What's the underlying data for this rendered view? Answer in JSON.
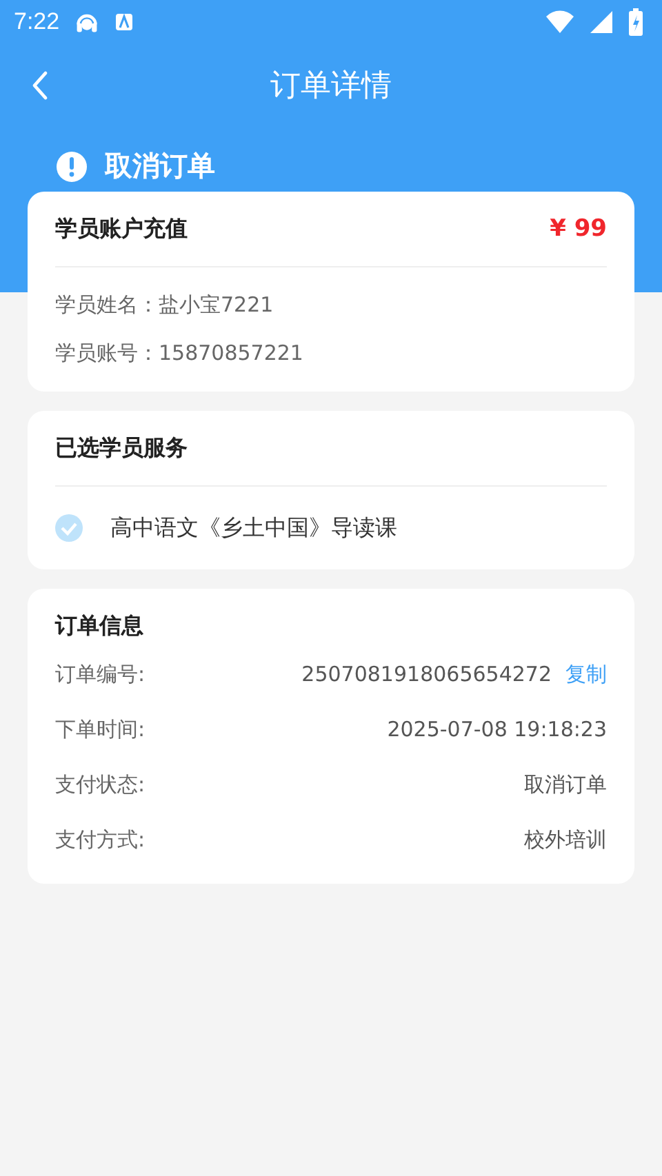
{
  "status_bar": {
    "time": "7:22"
  },
  "nav": {
    "title": "订单详情"
  },
  "order_status": {
    "label": "取消订单"
  },
  "account_card": {
    "title": "学员账户充值",
    "price": "¥ 99",
    "fields": [
      {
        "label": "学员姓名：",
        "value": "盐小宝7221"
      },
      {
        "label": "学员账号：",
        "value": "15870857221"
      }
    ]
  },
  "services_card": {
    "title": "已选学员服务",
    "items": [
      {
        "name": "高中语文《乡土中国》导读课",
        "checked": true
      }
    ]
  },
  "order_info": {
    "title": "订单信息",
    "rows": [
      {
        "label": "订单编号:",
        "value": "2507081918065654272",
        "action": "复制"
      },
      {
        "label": "下单时间:",
        "value": "2025-07-08 19:18:23"
      },
      {
        "label": "支付状态:",
        "value": "取消订单"
      },
      {
        "label": "支付方式:",
        "value": "校外培训"
      }
    ]
  }
}
